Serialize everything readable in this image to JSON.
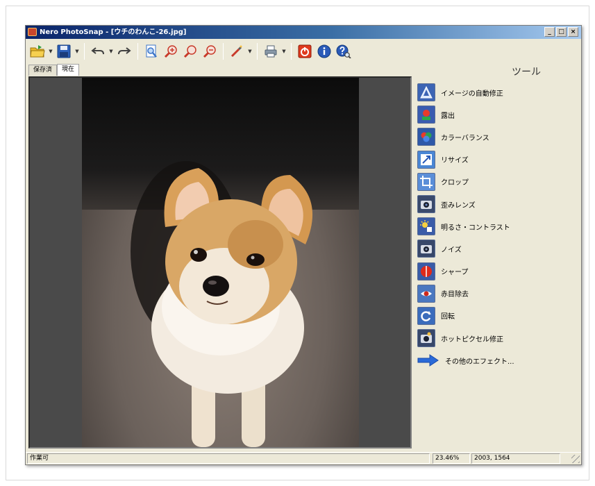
{
  "window": {
    "title": "Nero PhotoSnap - [ウチのわんこ-26.jpg]",
    "controls": {
      "minimize": "_",
      "maximize": "□",
      "close": "×"
    }
  },
  "toolbar": {
    "buttons": [
      {
        "name": "open",
        "icon": "open-folder-icon",
        "color": "#e8b828",
        "dropdown": true
      },
      {
        "name": "save",
        "icon": "save-disk-icon",
        "color": "#2c5fb8",
        "dropdown": true
      },
      {
        "name": "undo",
        "icon": "undo-icon",
        "color": "#404040",
        "dropdown": true
      },
      {
        "name": "redo",
        "icon": "redo-icon",
        "color": "#404040",
        "dropdown": false
      },
      {
        "name": "fit-view",
        "icon": "page-zoom-icon",
        "color": "#3a74c8",
        "dropdown": false
      },
      {
        "name": "zoom-in",
        "icon": "zoom-in-icon",
        "color": "#c83a2a",
        "dropdown": false
      },
      {
        "name": "zoom-actual",
        "icon": "zoom-actual-icon",
        "color": "#c83a2a",
        "dropdown": false
      },
      {
        "name": "zoom-out",
        "icon": "zoom-out-icon",
        "color": "#c83a2a",
        "dropdown": false
      },
      {
        "name": "tools",
        "icon": "wand-icon",
        "color": "#c83a2a",
        "dropdown": true
      },
      {
        "name": "print",
        "icon": "printer-icon",
        "color": "#506070",
        "dropdown": true
      },
      {
        "name": "exit",
        "icon": "power-icon",
        "color": "#e03a1e",
        "dropdown": false
      },
      {
        "name": "info",
        "icon": "info-icon",
        "color": "#2a5ab8",
        "dropdown": false
      },
      {
        "name": "help",
        "icon": "help-search-icon",
        "color": "#2a5ab8",
        "dropdown": false
      }
    ]
  },
  "tabs": [
    {
      "label": "保存済",
      "active": false
    },
    {
      "label": "現在",
      "active": true
    }
  ],
  "side_panel": {
    "title": "ツール",
    "tools": [
      {
        "label": "イメージの自動修正",
        "icon": "auto-fix-icon",
        "bg": "#3c64b4"
      },
      {
        "label": "露出",
        "icon": "exposure-icon",
        "bg": "#3a5cb0"
      },
      {
        "label": "カラーバランス",
        "icon": "color-balance-icon",
        "bg": "#2e58a8"
      },
      {
        "label": "リサイズ",
        "icon": "resize-icon",
        "bg": "#4a86d4"
      },
      {
        "label": "クロップ",
        "icon": "crop-icon",
        "bg": "#5a8ed8"
      },
      {
        "label": "歪みレンズ",
        "icon": "lens-distortion-icon",
        "bg": "#3a4a6c"
      },
      {
        "label": "明るさ・コントラスト",
        "icon": "brightness-contrast-icon",
        "bg": "#3a5ca8"
      },
      {
        "label": "ノイズ",
        "icon": "noise-icon",
        "bg": "#38486a"
      },
      {
        "label": "シャープ",
        "icon": "sharpen-icon",
        "bg": "#3a5ca8"
      },
      {
        "label": "赤目除去",
        "icon": "red-eye-icon",
        "bg": "#4a78c0"
      },
      {
        "label": "回転",
        "icon": "rotate-icon",
        "bg": "#3a6cbc"
      },
      {
        "label": "ホットピクセル修正",
        "icon": "hot-pixel-icon",
        "bg": "#38486a"
      },
      {
        "label": "その他のエフェクト...",
        "icon": "arrow-right-icon",
        "bg": "none"
      }
    ]
  },
  "status": {
    "text": "作業可",
    "zoom": "23.46%",
    "dimensions": "2003, 1564"
  }
}
